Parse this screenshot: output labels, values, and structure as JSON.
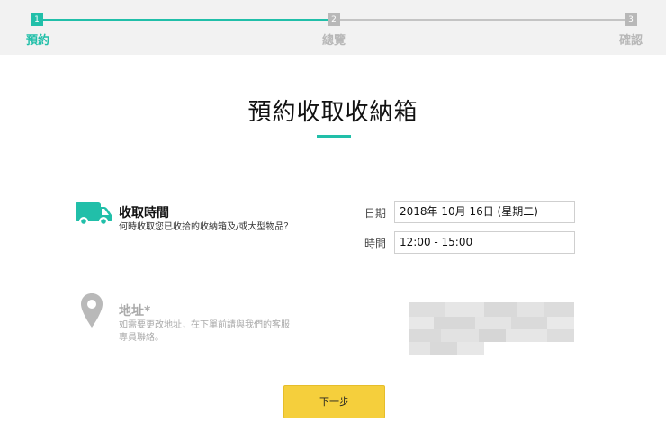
{
  "steps": [
    {
      "number": "1",
      "label": "預約"
    },
    {
      "number": "2",
      "label": "總覽"
    },
    {
      "number": "3",
      "label": "確認"
    }
  ],
  "colors": {
    "accent": "#21bfa9",
    "inactive": "#b8b8b8",
    "button": "#f5cf3c"
  },
  "page": {
    "title": "預約收取收納箱"
  },
  "pickup": {
    "icon": "van-icon",
    "title": "收取時間",
    "subtitle": "何時收取您已收拾的收納箱及/或大型物品？",
    "date_label": "日期",
    "date_value": "2018年 10月 16日 (星期二)",
    "time_label": "時間",
    "time_value": "12:00 - 15:00"
  },
  "address": {
    "icon": "location-pin-icon",
    "title": "地址*",
    "subtitle_line1": "如需要更改地址，在下單前請與我們的客服",
    "subtitle_line2": "專員聯絡。"
  },
  "actions": {
    "next_label": "下一步"
  }
}
